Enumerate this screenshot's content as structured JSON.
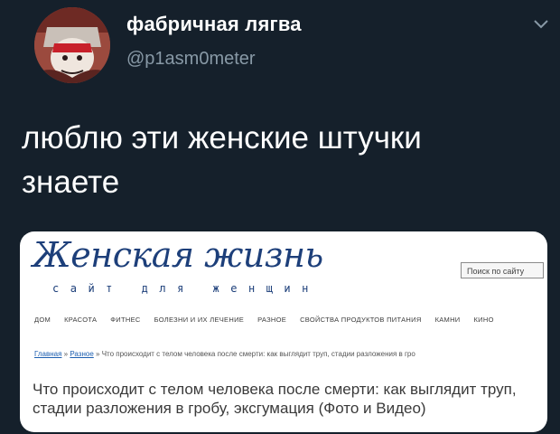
{
  "tweet": {
    "display_name": "фабричная лягва",
    "handle": "@p1asm0meter",
    "text_line1": "люблю эти женские штучки",
    "text_line2": "знаете"
  },
  "icons": {
    "menu": "chevron-down-icon",
    "avatar": "avatar-image"
  },
  "colors": {
    "background": "#15202b",
    "name": "#ffffff",
    "handle": "#8899a6",
    "site_brand": "#1d3f7a",
    "link": "#1d5fb0"
  },
  "card": {
    "site_logo": "Женская жизнь",
    "site_tagline": "сайт для женщин",
    "search_placeholder": "Поиск по сайту",
    "nav": [
      "ДОМ",
      "КРАСОТА",
      "ФИТНЕС",
      "БОЛЕЗНИ И ИХ ЛЕЧЕНИЕ",
      "РАЗНОЕ",
      "СВОЙСТВА ПРОДУКТОВ ПИТАНИЯ",
      "КАМНИ",
      "КИНО"
    ],
    "breadcrumb": {
      "home": "Главная",
      "sep1": " » ",
      "section": "Разное",
      "sep2": " » ",
      "current": "Что происходит с телом человека после смерти: как выглядит труп, стадии разложения в гро"
    },
    "article_title": "Что происходит с телом человека после смерти: как выглядит труп, стадии разложения в гробу, эксгумация (Фото и Видео)"
  }
}
